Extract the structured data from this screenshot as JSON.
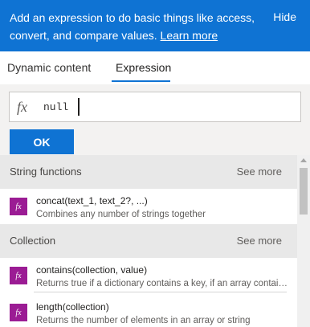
{
  "banner": {
    "message": "Add an expression to do basic things like access, convert, and compare values.",
    "learn_more": "Learn more",
    "hide_label": "Hide",
    "background_color": "#0f73d3"
  },
  "tabs": {
    "dynamic_content": "Dynamic content",
    "expression": "Expression",
    "active": "Expression"
  },
  "editor": {
    "fx_symbol": "fx",
    "value": "null",
    "ok_label": "OK"
  },
  "sections": [
    {
      "title": "String functions",
      "see_more": "See more",
      "items": [
        {
          "name": "concat(text_1, text_2?, ...)",
          "description": "Combines any number of strings together",
          "icon": "fx"
        }
      ]
    },
    {
      "title": "Collection",
      "see_more": "See more",
      "items": [
        {
          "name": "contains(collection, value)",
          "description": "Returns true if a dictionary contains a key, if an array contains a value",
          "icon": "fx"
        },
        {
          "name": "length(collection)",
          "description": "Returns the number of elements in an array or string",
          "icon": "fx"
        }
      ]
    }
  ],
  "colors": {
    "accent": "#0f73d3",
    "function_icon": "#9b1c94"
  }
}
